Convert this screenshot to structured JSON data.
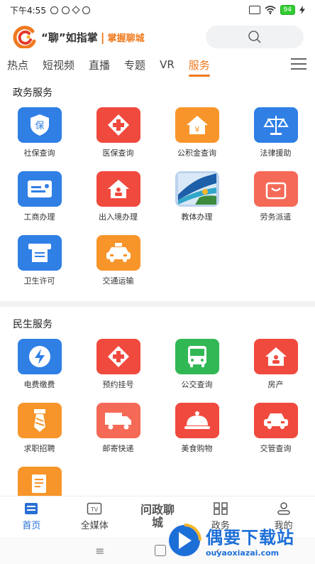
{
  "status_bar": {
    "time": "下午4:55",
    "battery": "94"
  },
  "header": {
    "brand": "“聊”如指掌",
    "slogan": "掌握聊城"
  },
  "tabs": [
    {
      "label": "热点"
    },
    {
      "label": "短视频"
    },
    {
      "label": "直播"
    },
    {
      "label": "专题"
    },
    {
      "label": "VR"
    },
    {
      "label": "服务",
      "active": true
    }
  ],
  "sections": [
    {
      "title": "政务服务",
      "items": [
        {
          "label": "社保查询",
          "icon": "shield-icon",
          "color": "#2f7fe5"
        },
        {
          "label": "医保查询",
          "icon": "medical-cross-icon",
          "color": "#f04a3e"
        },
        {
          "label": "公积金查询",
          "icon": "house-yen-icon",
          "color": "#f7952a"
        },
        {
          "label": "法律援助",
          "icon": "scales-icon",
          "color": "#2f7fe5"
        },
        {
          "label": "工商办理",
          "icon": "id-card-icon",
          "color": "#2f7fe5"
        },
        {
          "label": "出入境办理",
          "icon": "house-person-icon",
          "color": "#f04a3e"
        },
        {
          "label": "教体办理",
          "icon": "landscape-icon",
          "color": "#bcd3ee"
        },
        {
          "label": "劳务派遣",
          "icon": "bag-icon",
          "color": "#f46a57"
        },
        {
          "label": "卫生许可",
          "icon": "permit-icon",
          "color": "#2f7fe5"
        },
        {
          "label": "交通运输",
          "icon": "taxi-icon",
          "color": "#f7952a"
        }
      ]
    },
    {
      "title": "民生服务",
      "items": [
        {
          "label": "电费缴费",
          "icon": "lightning-icon",
          "color": "#2f7fe5"
        },
        {
          "label": "预约挂号",
          "icon": "medical-cross-icon",
          "color": "#f04a3e"
        },
        {
          "label": "公交查询",
          "icon": "bus-icon",
          "color": "#31b855"
        },
        {
          "label": "房产",
          "icon": "house-person-icon",
          "color": "#f04a3e"
        },
        {
          "label": "求职招聘",
          "icon": "tie-icon",
          "color": "#f7952a"
        },
        {
          "label": "邮寄快递",
          "icon": "truck-icon",
          "color": "#f46a57"
        },
        {
          "label": "美食购物",
          "icon": "cloche-icon",
          "color": "#f04a3e"
        },
        {
          "label": "交管查询",
          "icon": "car-icon",
          "color": "#f04a3e"
        },
        {
          "label": "",
          "icon": "document-icon",
          "color": "#f7952a"
        }
      ]
    }
  ],
  "bottom_nav": [
    {
      "label": "首页",
      "icon": "home-icon",
      "active": true
    },
    {
      "label": "全媒体",
      "icon": "tv-icon"
    },
    {
      "label": "问政聊城",
      "icon": "wenzheng-icon"
    },
    {
      "label": "政务",
      "icon": "grid-icon"
    },
    {
      "label": "我的",
      "icon": "user-icon"
    }
  ],
  "watermark": {
    "text": "偶要下载站",
    "url": "ouyaoxiazai.com"
  },
  "colors": {
    "accent": "#f07a1e",
    "nav_active": "#2a6fd6"
  }
}
